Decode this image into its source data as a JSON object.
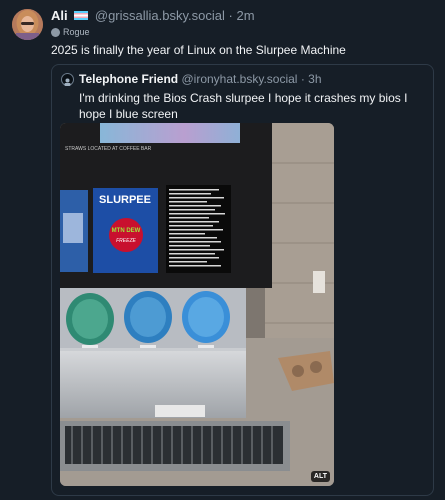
{
  "post": {
    "author_name": "Ali",
    "author_handle": "@grissallia.bsky.social",
    "separator": "·",
    "timestamp": "2m",
    "client_label": "Rogue",
    "text": "2025 is finally the year of Linux on the Slurpee Machine"
  },
  "quote": {
    "author_name": "Telephone Friend",
    "author_handle": "@ironyhat.bsky.social",
    "separator": "·",
    "timestamp": "3h",
    "text": "I'm drinking the Bios Crash slurpee I hope it crashes my bios I hope I blue screen",
    "image": {
      "alt_badge": "ALT",
      "top_sign": "STRAWS LOCATED AT COFFEE BAR",
      "slurpee_brand": "SLURPEE",
      "drink_brand": "MTN DEW",
      "drink_flavor": "FREEZE"
    }
  },
  "colors": {
    "background": "#161e27",
    "text": "#f1f3f5",
    "muted": "#8d99a6",
    "border": "#2e3a47"
  }
}
